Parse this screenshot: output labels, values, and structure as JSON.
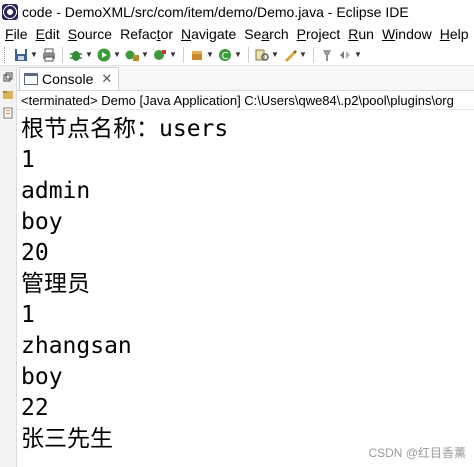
{
  "window": {
    "title": "code - DemoXML/src/com/item/demo/Demo.java - Eclipse IDE"
  },
  "menu": {
    "items": [
      {
        "m": "F",
        "rest": "ile"
      },
      {
        "m": "E",
        "rest": "dit"
      },
      {
        "m": "S",
        "rest": "ource"
      },
      {
        "pre": "Refac",
        "m": "t",
        "rest": "or"
      },
      {
        "m": "N",
        "rest": "avigate"
      },
      {
        "pre": "Se",
        "m": "a",
        "rest": "rch"
      },
      {
        "m": "P",
        "rest": "roject"
      },
      {
        "m": "R",
        "rest": "un"
      },
      {
        "m": "W",
        "rest": "indow"
      },
      {
        "m": "H",
        "rest": "elp"
      }
    ]
  },
  "toolbar": {
    "icons": [
      "save-icon",
      "print-icon",
      "debug-icon",
      "run-icon",
      "run-config-icon",
      "external-tools-icon",
      "new-class-icon",
      "new-package-icon",
      "search-icon",
      "annotation-icon",
      "pin-icon"
    ]
  },
  "console": {
    "tab_label": "Console",
    "close_glyph": "✕",
    "status": "<terminated> Demo [Java Application] C:\\Users\\qwe84\\.p2\\pool\\plugins\\org",
    "lines": [
      "根节点名称：users",
      "1",
      "admin",
      "boy",
      "20",
      "管理员",
      "1",
      "zhangsan",
      "boy",
      "22",
      "张三先生"
    ]
  },
  "watermark": "CSDN @红目香薰",
  "colors": {
    "run_green": "#3a9b3a",
    "debug_green": "#2f8f2f",
    "console_blue": "#5b6b83"
  }
}
